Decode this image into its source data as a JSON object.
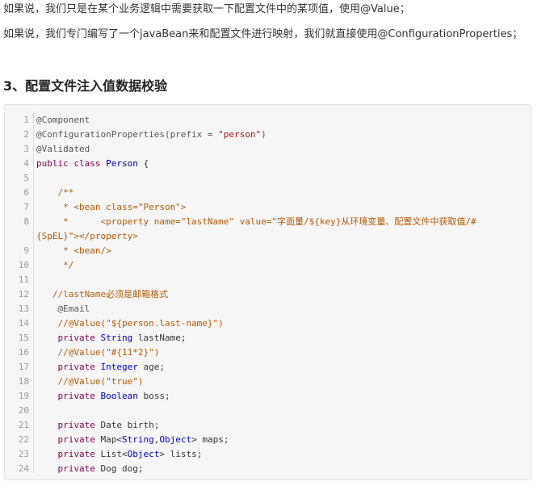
{
  "paragraphs": [
    "如果说，我们只是在某个业务逻辑中需要获取一下配置文件中的某项值，使用@Value；",
    "如果说，我们专门编写了一个javaBean来和配置文件进行映射，我们就直接使用@ConfigurationProperties；"
  ],
  "heading": "3、配置文件注入值数据校验",
  "code": {
    "line_numbers": [
      "1",
      "2",
      "3",
      "4",
      "5",
      "6",
      "7",
      "8",
      "",
      "9",
      "10",
      "11",
      "12",
      "13",
      "14",
      "15",
      "16",
      "17",
      "18",
      "19",
      "20",
      "21",
      "22",
      "23",
      "24"
    ],
    "lines": [
      [
        {
          "t": "@Component",
          "c": "an"
        }
      ],
      [
        {
          "t": "@ConfigurationProperties(prefix = ",
          "c": "an"
        },
        {
          "t": "\"person\"",
          "c": "st"
        },
        {
          "t": ")",
          "c": "an"
        }
      ],
      [
        {
          "t": "@Validated",
          "c": "an"
        }
      ],
      [
        {
          "t": "public",
          "c": "kw"
        },
        {
          "t": " ",
          "c": ""
        },
        {
          "t": "class",
          "c": "kw"
        },
        {
          "t": " ",
          "c": ""
        },
        {
          "t": "Person",
          "c": "ty"
        },
        {
          "t": " {",
          "c": ""
        }
      ],
      [],
      [
        {
          "t": "    /**",
          "c": "cm"
        }
      ],
      [
        {
          "t": "     * <bean class=\"Person\">",
          "c": "cm"
        }
      ],
      [
        {
          "t": "     *      <property name=\"lastName\" value=\"字面量/${key}从环境变量、配置文件中获取值/#",
          "c": "cm"
        }
      ],
      [
        {
          "t": "{SpEL}\"></property>",
          "c": "cm"
        }
      ],
      [
        {
          "t": "     * <bean/>",
          "c": "cm"
        }
      ],
      [
        {
          "t": "     */",
          "c": "cm"
        }
      ],
      [],
      [
        {
          "t": "   //lastName必须是邮箱格式",
          "c": "cm"
        }
      ],
      [
        {
          "t": "    @Email",
          "c": "an"
        }
      ],
      [
        {
          "t": "    //@Value(\"${person.last-name}\")",
          "c": "cm"
        }
      ],
      [
        {
          "t": "    ",
          "c": ""
        },
        {
          "t": "private",
          "c": "kw"
        },
        {
          "t": " ",
          "c": ""
        },
        {
          "t": "String",
          "c": "ty"
        },
        {
          "t": " lastName;",
          "c": ""
        }
      ],
      [
        {
          "t": "    //@Value(\"#{11*2}\")",
          "c": "cm"
        }
      ],
      [
        {
          "t": "    ",
          "c": ""
        },
        {
          "t": "private",
          "c": "kw"
        },
        {
          "t": " ",
          "c": ""
        },
        {
          "t": "Integer",
          "c": "ty"
        },
        {
          "t": " age;",
          "c": ""
        }
      ],
      [
        {
          "t": "    //@Value(\"true\")",
          "c": "cm"
        }
      ],
      [
        {
          "t": "    ",
          "c": ""
        },
        {
          "t": "private",
          "c": "kw"
        },
        {
          "t": " ",
          "c": ""
        },
        {
          "t": "Boolean",
          "c": "ty"
        },
        {
          "t": " boss;",
          "c": ""
        }
      ],
      [],
      [
        {
          "t": "    ",
          "c": ""
        },
        {
          "t": "private",
          "c": "kw"
        },
        {
          "t": " Date birth;",
          "c": ""
        }
      ],
      [
        {
          "t": "    ",
          "c": ""
        },
        {
          "t": "private",
          "c": "kw"
        },
        {
          "t": " Map<",
          "c": ""
        },
        {
          "t": "String",
          "c": "ty"
        },
        {
          "t": ",",
          "c": ""
        },
        {
          "t": "Object",
          "c": "ty"
        },
        {
          "t": "> maps;",
          "c": ""
        }
      ],
      [
        {
          "t": "    ",
          "c": ""
        },
        {
          "t": "private",
          "c": "kw"
        },
        {
          "t": " List<",
          "c": ""
        },
        {
          "t": "Object",
          "c": "ty"
        },
        {
          "t": "> lists;",
          "c": ""
        }
      ],
      [
        {
          "t": "    ",
          "c": ""
        },
        {
          "t": "private",
          "c": "kw"
        },
        {
          "t": " Dog dog;",
          "c": ""
        }
      ]
    ]
  }
}
